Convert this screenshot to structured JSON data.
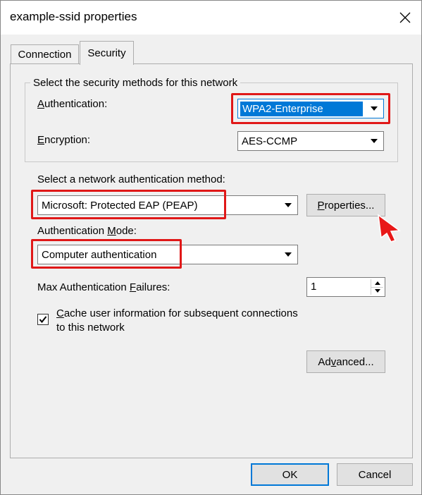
{
  "window": {
    "title": "example-ssid properties"
  },
  "tabs": [
    {
      "label": "Connection",
      "active": false
    },
    {
      "label": "Security",
      "active": true
    }
  ],
  "security_group": {
    "legend": "Select the security methods for this network",
    "authentication": {
      "label_prefix": "",
      "label_mnemonic": "A",
      "label_rest": "uthentication:",
      "value": "WPA2-Enterprise"
    },
    "encryption": {
      "label_mnemonic": "E",
      "label_rest": "ncryption:",
      "value": "AES-CCMP"
    }
  },
  "auth_method": {
    "label_a": "Select a network authentication method:",
    "value": "Microsoft: Protected EAP (PEAP)",
    "properties_button": {
      "label_a": "P",
      "label_b": "roperties..."
    }
  },
  "auth_mode": {
    "label_a": "Authentication ",
    "label_mnemonic": "M",
    "label_b": "ode:",
    "value": "Computer authentication"
  },
  "max_failures": {
    "label_a": "Max Authentication ",
    "label_mnemonic": "F",
    "label_b": "ailures:",
    "value": "1"
  },
  "cache_checkbox": {
    "checked": true,
    "line1_mnemonic": "C",
    "line1_rest": "ache user information for subsequent connections",
    "line2": "to this network"
  },
  "advanced_button": {
    "label_a": "Ad",
    "label_mnemonic": "v",
    "label_b": "anced..."
  },
  "footer": {
    "ok_label": "OK",
    "cancel_label": "Cancel"
  },
  "colors": {
    "highlight": "#e01818",
    "selection": "#0078d7",
    "dialog_bg": "#f0f0f0"
  },
  "icons": {
    "close": "close-icon",
    "dropdown": "chevron-down-icon",
    "cursor": "mouse-pointer-icon"
  }
}
